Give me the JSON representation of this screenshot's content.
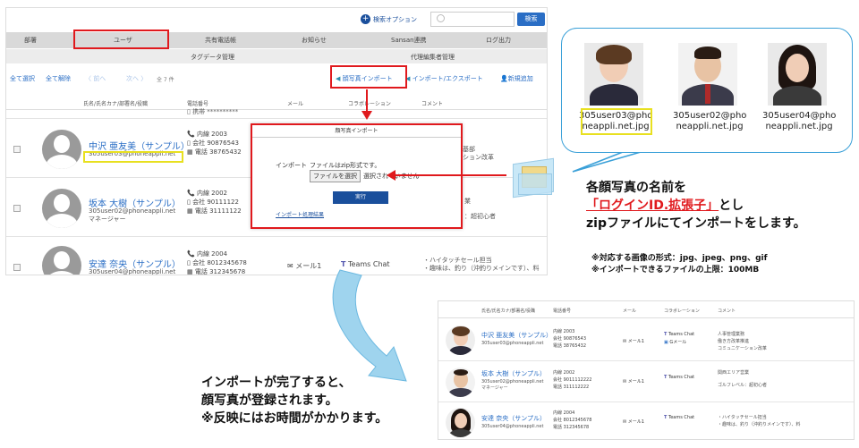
{
  "top": {
    "search_option": "検索オプション",
    "search_button": "検索"
  },
  "nav": [
    "部署",
    "ユーザ",
    "共有電話帳",
    "お知らせ",
    "Sansan連携",
    "ログ出力"
  ],
  "subnav": [
    "タグデータ管理",
    "代理編集者管理"
  ],
  "actions": {
    "select_all": "全て選択",
    "deselect_all": "全て解除",
    "prev": "〈 前へ",
    "next": "次へ 〉",
    "count": "全 7 件",
    "photo_import": "顔写真インポート",
    "import_export": "インポート/エクスポート",
    "add_new": "新規追加"
  },
  "table_headers": [
    "氏名/氏名カナ/部署名/役職",
    "電話番号",
    "メール",
    "コラボレーション",
    "コメント"
  ],
  "rows": [
    {
      "name": "中沢 亜友美（サンプル）",
      "id": "305user03@phoneappli.net",
      "role": "",
      "ext": "内線 2003",
      "company": "会社 90876543",
      "tel": "電話 38765432",
      "comment1": "基部",
      "comment2": "ション改革"
    },
    {
      "name": "坂本 大樹（サンプル）",
      "id": "305user02@phoneappli.net",
      "role": "マネージャー",
      "ext": "内線 2002",
      "company": "会社 90111122",
      "tel": "電話 31111122",
      "comment1": "業",
      "comment2": "：超初心者"
    },
    {
      "name": "安達 奈央（サンプル）",
      "id": "305user04@phoneappli.net",
      "role": "",
      "ext": "内線 2004",
      "company": "会社 8012345678",
      "tel": "電話 312345678",
      "mail": "メール1",
      "teams": "Teams Chat",
      "comment1": "・ハイタッチセール担当",
      "comment2": "・趣味は、釣り（沖釣りメインです）、料"
    }
  ],
  "modal": {
    "title": "顔写真インポート",
    "label": "インポート",
    "desc": "ファイルはzip形式です。",
    "file_button": "ファイルを選択",
    "no_file": "選択されていません",
    "run": "実行",
    "result_link": "インポート処理結果"
  },
  "photos": [
    {
      "cap1": "305user03@pho",
      "cap2": "neappli.net.jpg"
    },
    {
      "cap1": "305user02@pho",
      "cap2": "neappli.net.jpg"
    },
    {
      "cap1": "305user04@pho",
      "cap2": "neappli.net.jpg"
    }
  ],
  "explain": {
    "line1": "各顔写真の名前を",
    "line2_red": "「ログインID.拡張子」",
    "line2_rest": "とし",
    "line3": "zipファイルにてインポートをします。",
    "note1": "※対応する画像の形式：jpg、jpeg、png、gif",
    "note2": "※インポートできるファイルの上限：100MB"
  },
  "complete": {
    "line1": "インポートが完了すると、",
    "line2": "顔写真が登録されます。",
    "line3": "※反映にはお時間がかかります。"
  },
  "result": {
    "headers": [
      "氏名/氏名カナ/部署名/役職",
      "電話番号",
      "メール",
      "コラボレーション",
      "コメント"
    ],
    "rows": [
      {
        "name": "中沢 亜友美（サンプル）",
        "id": "305user03@phoneappli.net",
        "role": "",
        "ext": "内線 2003",
        "company": "会社 90876543",
        "tel": "電話 38765432",
        "mail": "メール1",
        "teams": "Teams Chat",
        "gmail": "Gメール",
        "c1": "人事管理業務",
        "c2": "働き方改革推進",
        "c3": "コミュニケーション改革"
      },
      {
        "name": "坂本 大樹（サンプル）",
        "id": "305user02@phoneappli.net",
        "role": "マネージャー",
        "ext": "内線 2002",
        "company": "会社 9011112222",
        "tel": "電話 311112222",
        "mail": "メール1",
        "teams": "Teams Chat",
        "gmail": "",
        "c1": "関西エリア営業",
        "c2": "",
        "c3": "ゴルフレベル：超初心者"
      },
      {
        "name": "安達 奈央（サンプル）",
        "id": "305user04@phoneappli.net",
        "role": "",
        "ext": "内線 2004",
        "company": "会社 8012345678",
        "tel": "電話 312345678",
        "mail": "メール1",
        "teams": "Teams Chat",
        "gmail": "",
        "c1": "・ハイタッチセール担当",
        "c2": "・趣味は、釣り（沖釣りメインです）、料",
        "c3": ""
      }
    ]
  }
}
